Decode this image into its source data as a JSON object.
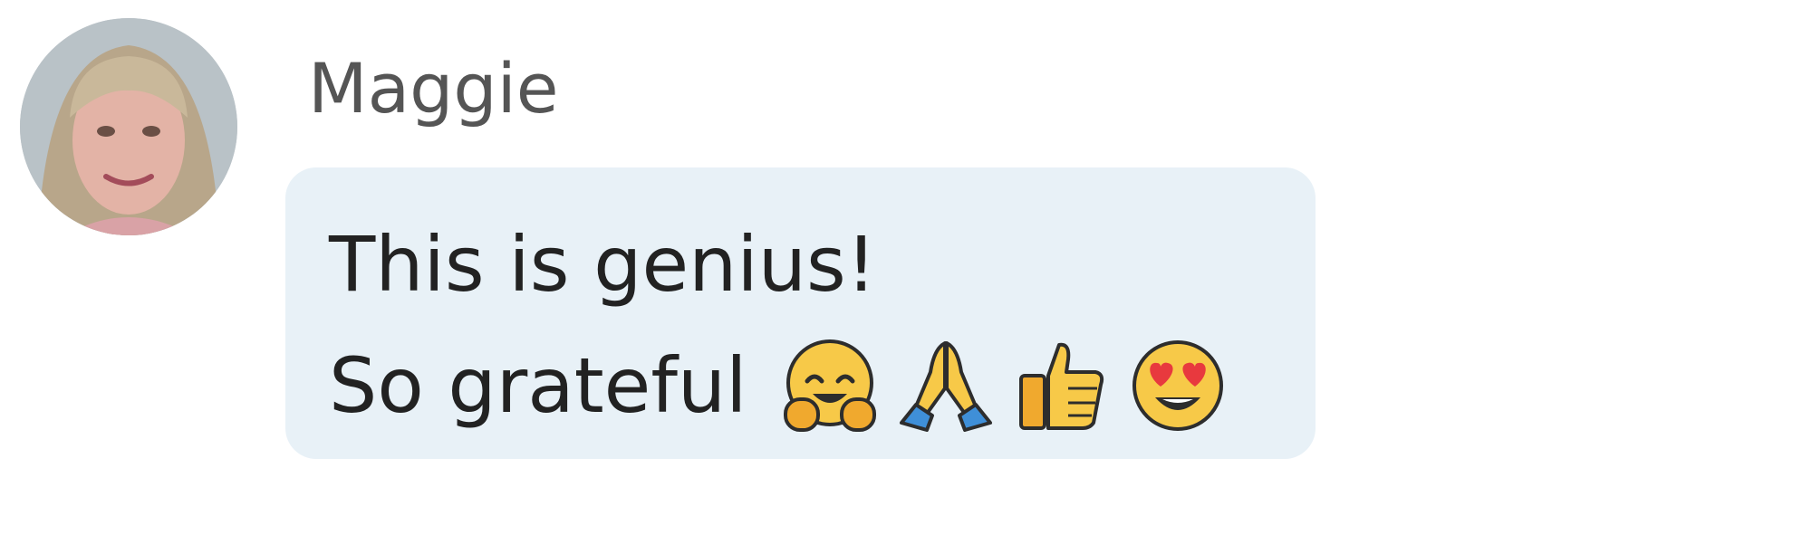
{
  "message": {
    "sender_name": "Maggie",
    "lines": [
      "This is genius!",
      "So grateful"
    ],
    "emojis": [
      "hugging-face-icon",
      "folded-hands-icon",
      "thumbs-up-icon",
      "heart-eyes-face-icon"
    ]
  },
  "colors": {
    "bubble_background": "#e8f1f7",
    "sender_text": "#555555",
    "message_text": "#222222"
  }
}
